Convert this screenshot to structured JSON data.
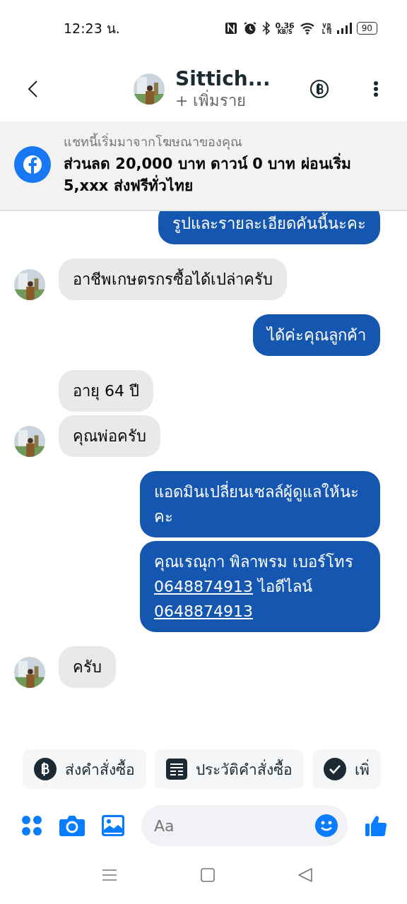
{
  "status_bar": {
    "time": "12:23 น.",
    "speed": "0.36",
    "speed_unit": "KB/S",
    "battery": "90"
  },
  "header": {
    "name": "Sittich...",
    "subtitle": "+ เพิ่มราย"
  },
  "ad_banner": {
    "caption": "แชทนี้เริ่มมาจากโฆษณาของคุณ",
    "title": "ส่วนลด 20,000 บาท ดาวน์ 0 บาท ผ่อนเริ่ม 5,xxx ส่งฟรีทั่วไทย"
  },
  "messages": [
    {
      "kind": "outgoing",
      "avatar": false,
      "parts": [
        {
          "kind": "text",
          "text": "รูปและรายละเอียดคันนี้นะคะ"
        }
      ]
    },
    {
      "kind": "incoming",
      "avatar": true,
      "parts": [
        {
          "kind": "text",
          "text": "อาชีพเกษตรกรซื้อได้เปล่าครับ"
        }
      ]
    },
    {
      "kind": "outgoing",
      "avatar": false,
      "parts": [
        {
          "kind": "text",
          "text": "ได้ค่ะคุณลูกค้า"
        }
      ]
    },
    {
      "kind": "incoming",
      "avatar": false,
      "parts": [
        {
          "kind": "text",
          "text": "อายุ 64 ปี"
        }
      ]
    },
    {
      "kind": "incoming",
      "avatar": true,
      "parts": [
        {
          "kind": "text",
          "text": "คุณพ่อครับ"
        }
      ]
    },
    {
      "kind": "outgoing",
      "avatar": false,
      "parts": [
        {
          "kind": "text",
          "text": "แอดมินเปลี่ยนเซลล์ผู้ดูแลให้นะคะ"
        }
      ]
    },
    {
      "kind": "outgoing",
      "avatar": false,
      "parts": [
        {
          "kind": "text",
          "text": "คุณเรณุกา พิลาพรม เบอร์โทร "
        },
        {
          "kind": "link",
          "text": "0648874913"
        },
        {
          "kind": "text",
          "text": " ไอดีไลน์ "
        },
        {
          "kind": "link",
          "text": "0648874913"
        }
      ]
    },
    {
      "kind": "incoming",
      "avatar": true,
      "parts": [
        {
          "kind": "text",
          "text": "ครับ"
        }
      ]
    }
  ],
  "quick_replies": [
    {
      "kind": "baht",
      "label": "ส่งคำสั่งซื้อ"
    },
    {
      "kind": "list",
      "label": "ประวัติคำสั่งซื้อ"
    },
    {
      "kind": "check",
      "label": "เพิ่"
    }
  ],
  "composer": {
    "placeholder": "Aa"
  }
}
